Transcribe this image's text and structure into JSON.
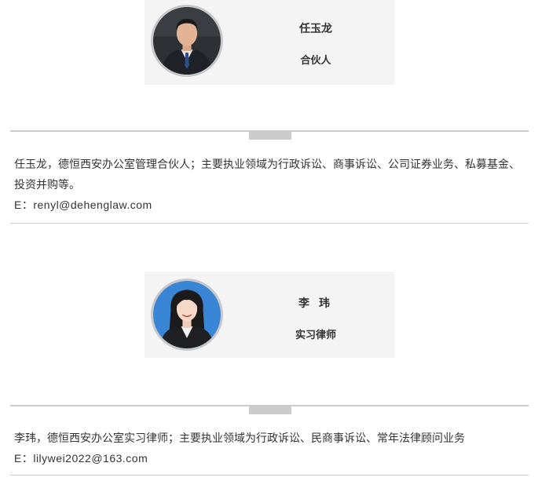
{
  "profiles": [
    {
      "name": "任玉龙",
      "role": "合伙人",
      "bio": "任玉龙，德恒西安办公室管理合伙人；主要执业领域为行政诉讼、商事诉讼、公司证券业务、私募基金、投资并购等。",
      "email": "E：renyl@dehenglaw.com"
    },
    {
      "name": "李 玮",
      "role": "实习律师",
      "bio": "李玮，德恒西安办公室实习律师；主要执业领域为行政诉讼、民商事诉讼、常年法律顾问业务",
      "email": "E：lilywei2022@163.com"
    }
  ],
  "colors": {
    "card_background": "#f4f4f4",
    "divider": "#cccccc",
    "text": "#333333",
    "avatar_border": "#c8c8c8",
    "avatar2_background": "#3a86d6"
  },
  "icons": {
    "avatar_1": "portrait-man-suit",
    "avatar_2": "portrait-woman-suit"
  }
}
